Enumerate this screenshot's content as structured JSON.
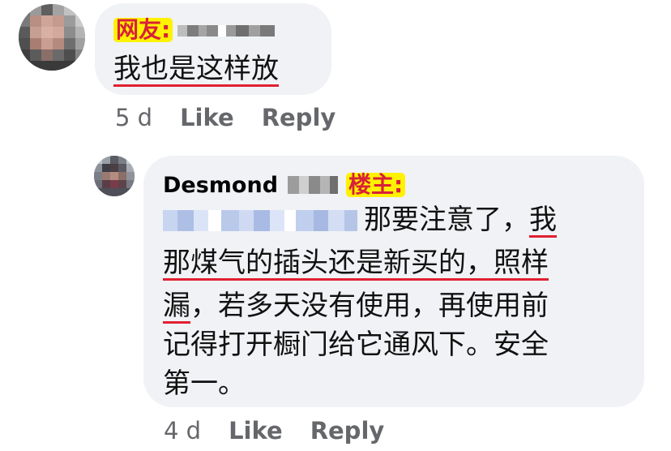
{
  "comment1": {
    "badge": "网友:",
    "text": "我也是这样放",
    "time": "5 d",
    "like": "Like",
    "reply": "Reply"
  },
  "reply1": {
    "author": "Desmond",
    "badge": "楼主:",
    "line1_suffix": "那要注意了，",
    "line1_end": "我",
    "line2": "那煤气的插头还是新买的，照样",
    "line3_start": "漏",
    "line3_rest": "，若多天没有使用，再使用前",
    "line4": "记得打开橱门给它通风下。安全",
    "line5": "第一。",
    "time": "4 d",
    "like": "Like",
    "reply": "Reply"
  },
  "colors": {
    "bubble": "#f0f2f5",
    "badge_bg": "#fff200",
    "badge_text": "#d8213a",
    "underline": "#e02030",
    "meta_text": "#65676b"
  }
}
